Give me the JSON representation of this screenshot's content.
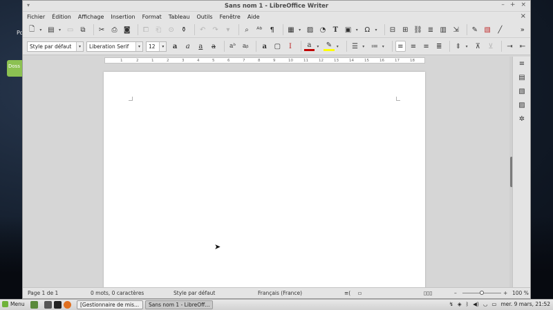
{
  "desktop": {
    "label": "Po",
    "folder_label": "Doss"
  },
  "window": {
    "title": "Sans nom 1 - LibreOffice Writer",
    "controls": {
      "minimize": "–",
      "maximize": "+",
      "close": "×"
    }
  },
  "menubar": {
    "items": [
      "Fichier",
      "Édition",
      "Affichage",
      "Insertion",
      "Format",
      "Tableau",
      "Outils",
      "Fenêtre",
      "Aide"
    ],
    "close_doc": "×"
  },
  "toolbar2": {
    "style_value": "Style par défaut",
    "font_value": "Liberation Serif",
    "size_value": "12"
  },
  "ruler": {
    "ticks": [
      "1",
      "2",
      "1",
      "2",
      "3",
      "4",
      "5",
      "6",
      "7",
      "8",
      "9",
      "10",
      "11",
      "12",
      "13",
      "14",
      "15",
      "16",
      "17",
      "18"
    ]
  },
  "statusbar": {
    "page": "Page 1 de 1",
    "words": "0 mots, 0 caractères",
    "style": "Style par défaut",
    "language": "Français (France)",
    "zoom": "100 %",
    "zoom_minus": "–",
    "zoom_plus": "+"
  },
  "taskbar": {
    "menu_label": "Menu",
    "tasks": [
      "[Gestionnaire de mis...",
      "Sans nom 1 - LibreOff..."
    ],
    "clock": "mer. 9 mars, 21:52"
  },
  "colors": {
    "font_color": "#c00000",
    "highlight": "#ffff00",
    "taskbar_leaf": "#6fb23a"
  }
}
